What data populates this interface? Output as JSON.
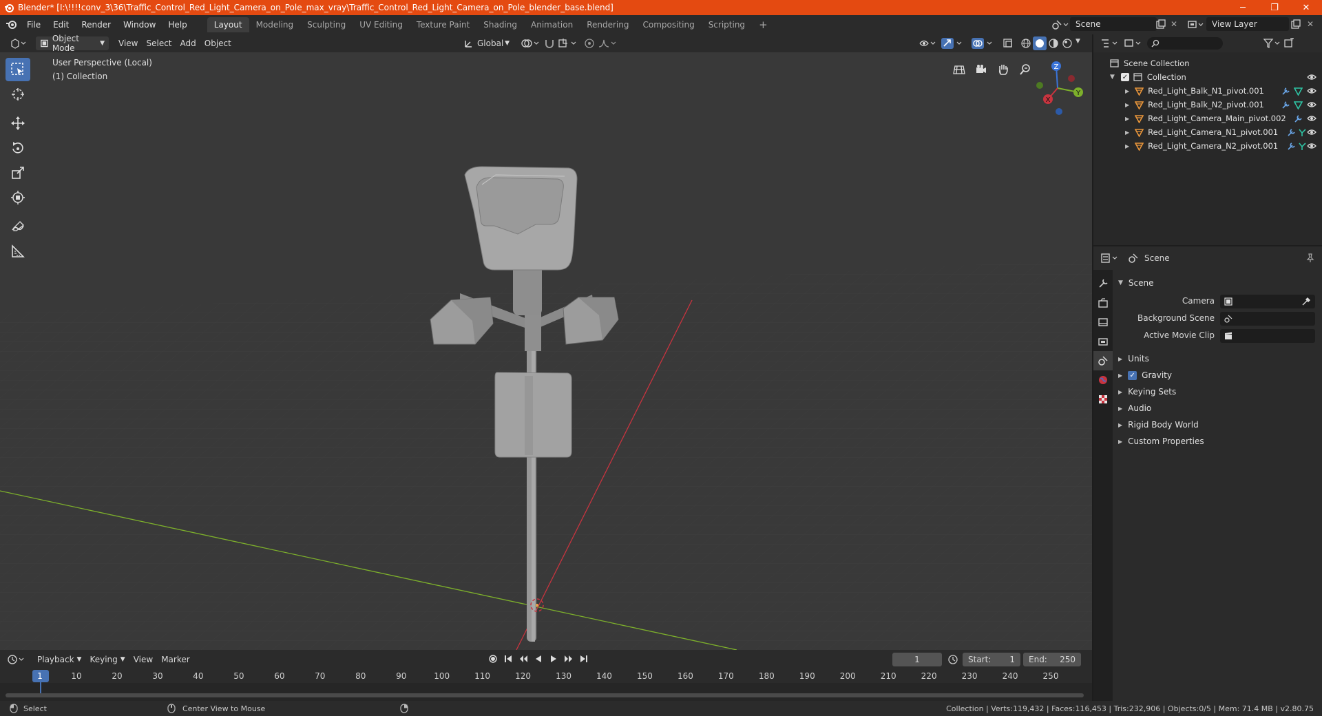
{
  "window": {
    "title": "Blender* [I:\\!!!!conv_3\\36\\Traffic_Control_Red_Light_Camera_on_Pole_max_vray\\Traffic_Control_Red_Light_Camera_on_Pole_blender_base.blend]",
    "minimize": "─",
    "maximize": "❐",
    "close": "✕"
  },
  "menu": [
    "File",
    "Edit",
    "Render",
    "Window",
    "Help"
  ],
  "workspaces": [
    "Layout",
    "Modeling",
    "Sculpting",
    "UV Editing",
    "Texture Paint",
    "Shading",
    "Animation",
    "Rendering",
    "Compositing",
    "Scripting"
  ],
  "active_workspace": "Layout",
  "add_workspace": "+",
  "scene_name": "Scene",
  "view_layer": "View Layer",
  "viewport_header": {
    "mode": "Object Mode",
    "menus": [
      "View",
      "Select",
      "Add",
      "Object"
    ],
    "orientation": "Global"
  },
  "viewport": {
    "perspective": "User Perspective (Local)",
    "collection": "(1) Collection",
    "gizmo": {
      "z": "Z",
      "y": "Y",
      "x": "X"
    }
  },
  "outliner": {
    "root": "Scene Collection",
    "collection": "Collection",
    "items": [
      "Red_Light_Balk_N1_pivot.001",
      "Red_Light_Balk_N2_pivot.001",
      "Red_Light_Camera_Main_pivot.002",
      "Red_Light_Camera_N1_pivot.001",
      "Red_Light_Camera_N2_pivot.001"
    ]
  },
  "properties": {
    "context": "Scene",
    "panel": "Scene",
    "fields": [
      {
        "label": "Camera"
      },
      {
        "label": "Background Scene"
      },
      {
        "label": "Active Movie Clip"
      }
    ],
    "subpanels": [
      "Units",
      "Gravity",
      "Keying Sets",
      "Audio",
      "Rigid Body World",
      "Custom Properties"
    ]
  },
  "timeline": {
    "menus": [
      "Playback",
      "Keying",
      "View",
      "Marker"
    ],
    "current_frame": "1",
    "start_label": "Start:",
    "start": "1",
    "end_label": "End:",
    "end": "250",
    "ticks": [
      "1",
      "10",
      "20",
      "30",
      "40",
      "50",
      "60",
      "70",
      "80",
      "90",
      "100",
      "110",
      "120",
      "130",
      "140",
      "150",
      "160",
      "170",
      "180",
      "190",
      "200",
      "210",
      "220",
      "230",
      "240",
      "250"
    ]
  },
  "status": {
    "left": "Select",
    "middle": "Center View to Mouse",
    "right": "Collection | Verts:119,432 | Faces:116,453 | Tris:232,906 | Objects:0/5 | Mem: 71.4 MB | v2.80.75"
  },
  "colors": {
    "titlebar": "#e44a11",
    "accent": "#4772b3",
    "x_axis": "#c8343f",
    "y_axis": "#7db02b",
    "z_axis": "#3a74d8"
  }
}
